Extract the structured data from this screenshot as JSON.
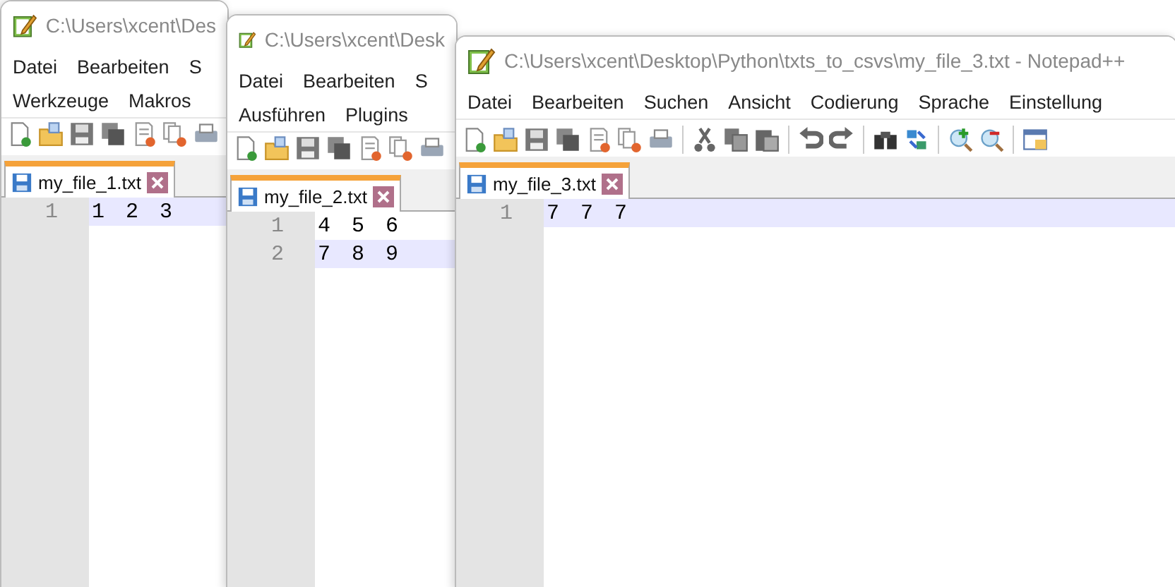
{
  "windows": [
    {
      "title": "C:\\Users\\xcent\\Des",
      "menu_rows": [
        [
          "Datei",
          "Bearbeiten",
          "S"
        ],
        [
          "Werkzeuge",
          "Makros"
        ]
      ],
      "tab": {
        "label": "my_file_1.txt"
      },
      "lines": [
        {
          "number": "1",
          "text": "1 2 3",
          "current": true
        }
      ]
    },
    {
      "title": "C:\\Users\\xcent\\Desk",
      "menu_rows": [
        [
          "Datei",
          "Bearbeiten",
          "S"
        ],
        [
          "Ausführen",
          "Plugins"
        ]
      ],
      "tab": {
        "label": "my_file_2.txt"
      },
      "lines": [
        {
          "number": "1",
          "text": "4 5 6",
          "current": false
        },
        {
          "number": "2",
          "text": "7 8 9",
          "current": true
        }
      ]
    },
    {
      "title": "C:\\Users\\xcent\\Desktop\\Python\\txts_to_csvs\\my_file_3.txt - Notepad++",
      "menu_rows": [
        [
          "Datei",
          "Bearbeiten",
          "Suchen",
          "Ansicht",
          "Codierung",
          "Sprache",
          "Einstellung"
        ]
      ],
      "tab": {
        "label": "my_file_3.txt"
      },
      "lines": [
        {
          "number": "1",
          "text": "7 7 7",
          "current": true
        }
      ]
    }
  ]
}
